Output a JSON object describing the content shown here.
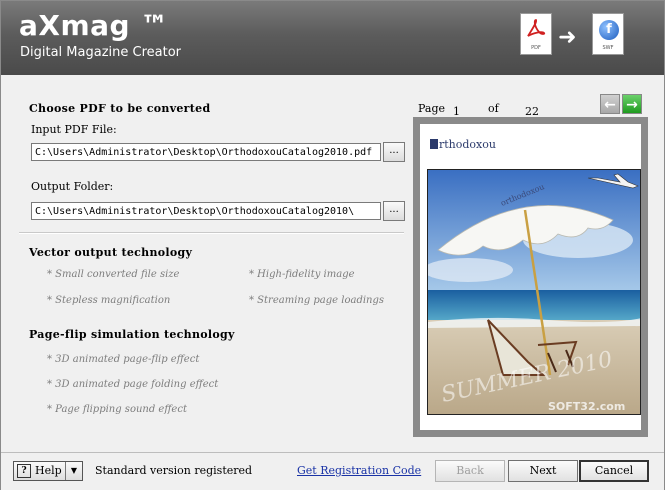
{
  "header": {
    "brand": "aXmag ™",
    "subtitle": "Digital Magazine Creator",
    "pdf_label": "PDF",
    "swf_label": "SWF"
  },
  "convert": {
    "title": "Choose PDF to be converted",
    "input_label": "Input PDF File:",
    "input_value": "C:\\Users\\Administrator\\Desktop\\OrthodoxouCatalog2010.pdf",
    "output_label": "Output Folder:",
    "output_value": "C:\\Users\\Administrator\\Desktop\\OrthodoxouCatalog2010\\",
    "browse_label": "..."
  },
  "vector": {
    "title": "Vector output technology",
    "features": [
      "* Small converted file size",
      "* High-fidelity image",
      "* Stepless magnification",
      "* Streaming page loadings"
    ]
  },
  "pageflip": {
    "title": "Page-flip simulation technology",
    "features": [
      "* 3D animated page-flip effect",
      "* 3D animated page folding effect",
      "* Page flipping sound effect"
    ]
  },
  "pager": {
    "page_label": "Page",
    "current": "1",
    "of_label": "of",
    "total": "22",
    "prev_icon": "arrow-left-icon",
    "next_icon": "arrow-right-icon"
  },
  "preview": {
    "magazine_logo": "rthodoxou",
    "umbrella_text": "orthodoxou",
    "watermark": "SOFT32.com",
    "photo_caption": "SUMMER 2010"
  },
  "footer": {
    "help_label": "Help",
    "status": "Standard version registered",
    "reg_link": "Get Registration Code",
    "back_label": "Back",
    "next_label": "Next",
    "cancel_label": "Cancel"
  },
  "colors": {
    "header": "#5c5c5c",
    "link": "#1a33a6",
    "next_arrow": "#2aa52a"
  }
}
